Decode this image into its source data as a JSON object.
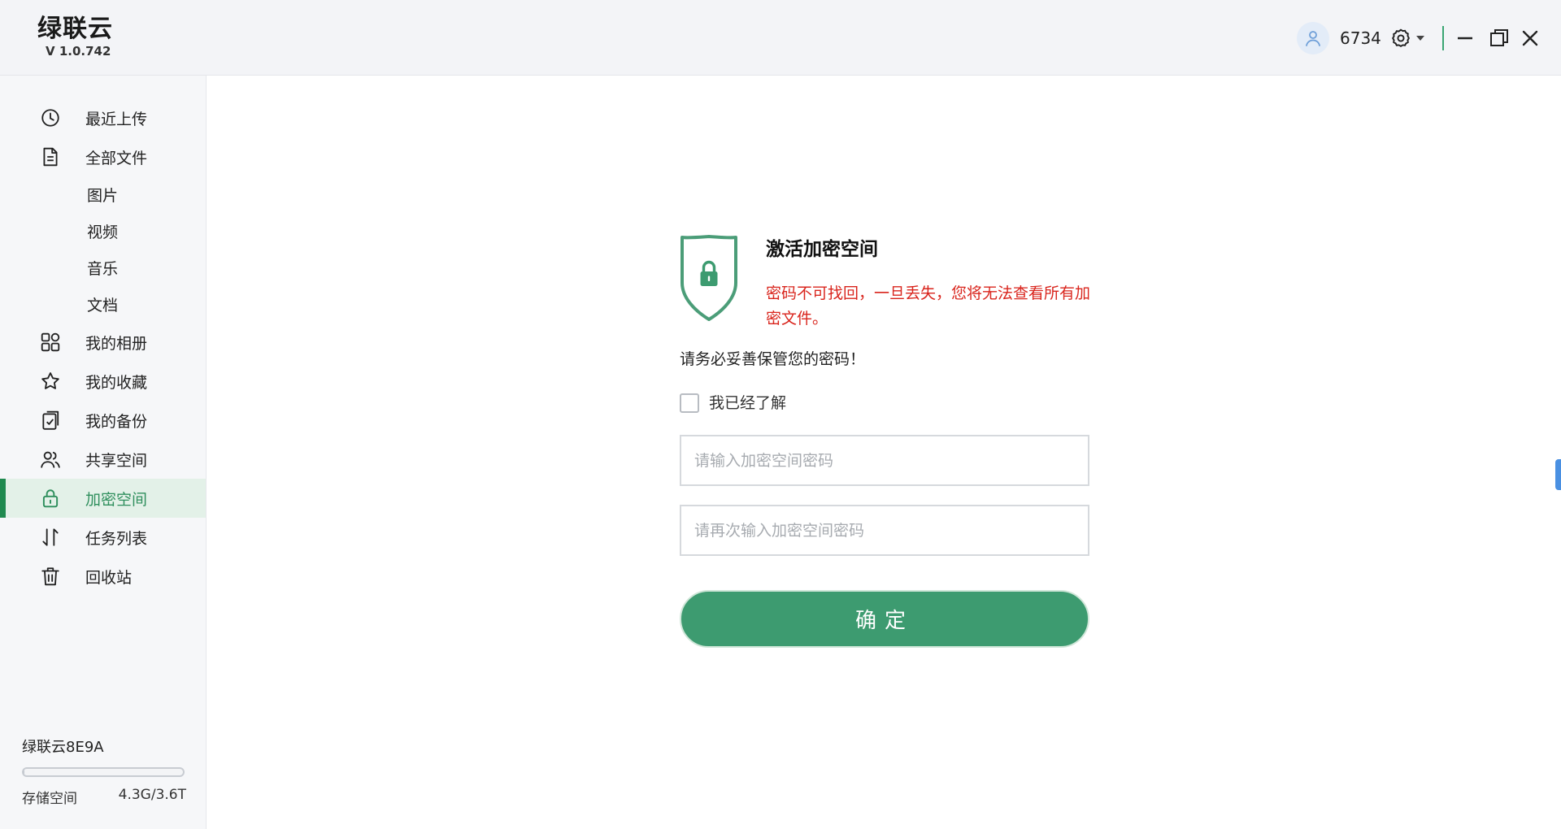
{
  "app": {
    "title": "绿联云",
    "version": "V 1.0.742"
  },
  "header": {
    "user_id": "6734",
    "accent_color": "#3aa572"
  },
  "sidebar": {
    "items": [
      {
        "label": "最近上传",
        "icon": "clock-icon"
      },
      {
        "label": "全部文件",
        "icon": "file-icon"
      },
      {
        "label": "图片"
      },
      {
        "label": "视频"
      },
      {
        "label": "音乐"
      },
      {
        "label": "文档"
      },
      {
        "label": "我的相册",
        "icon": "grid-icon"
      },
      {
        "label": "我的收藏",
        "icon": "star-icon"
      },
      {
        "label": "我的备份",
        "icon": "backup-icon"
      },
      {
        "label": "共享空间",
        "icon": "users-icon"
      },
      {
        "label": "加密空间",
        "icon": "lock-icon",
        "active": true
      },
      {
        "label": "任务列表",
        "icon": "transfer-icon"
      },
      {
        "label": "回收站",
        "icon": "trash-icon"
      }
    ],
    "active_color": "#1f8a4f",
    "storage": {
      "device_name": "绿联云8E9A",
      "label": "存储空间",
      "usage": "4.3G/3.6T",
      "fill_fraction": 0.0012
    }
  },
  "encrypted_space": {
    "icon": "shield-lock-icon",
    "heading": "激活加密空间",
    "warning": "密码不可找回，一旦丢失，您将无法查看所有加密文件。",
    "notice": "请务必妥善保管您的密码！",
    "agree_label": "我已经了解",
    "agree_checked": false,
    "password_placeholder": "请输入加密空间密码",
    "password_confirm_placeholder": "请再次输入加密空间密码",
    "password_value": "",
    "password_confirm_value": "",
    "confirm_label": "确定",
    "warning_color": "#d9251d",
    "button_color": "#3d9b70"
  }
}
